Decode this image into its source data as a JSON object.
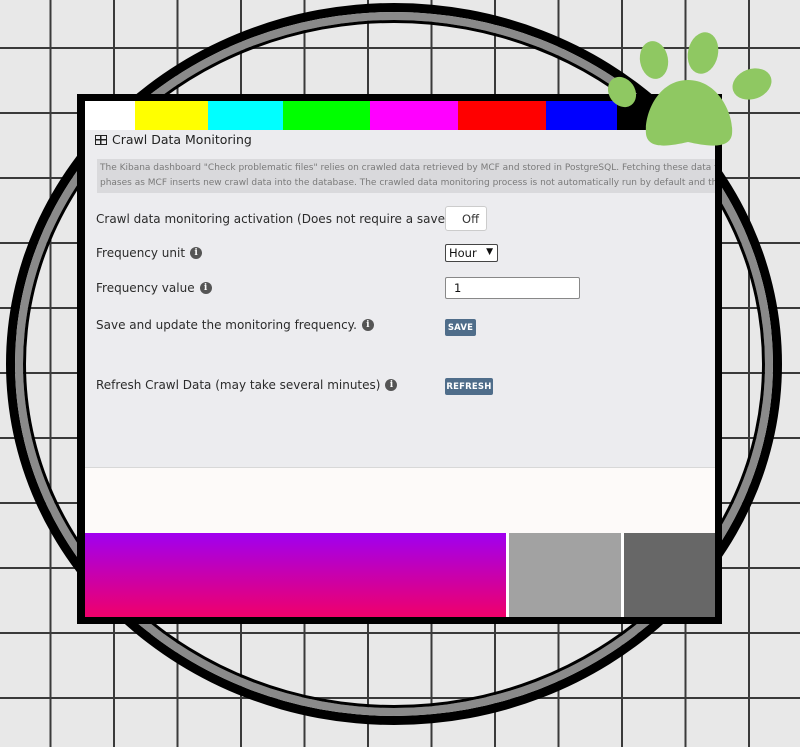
{
  "colors": {
    "bars": [
      "#ffffff",
      "#ffff00",
      "#00ffff",
      "#00ff00",
      "#ff00ff",
      "#ff0000",
      "#0000ff",
      "#000000"
    ],
    "button": "#4f6d8a",
    "paw": "#8fc862"
  },
  "panel": {
    "title": "Crawl Data Monitoring",
    "title_icon": "table-icon",
    "info_line1": "The Kibana dashboard \"Check problematic files\" relies on crawled data retrieved by MCF and stored in PostgreSQL. Fetching these data from",
    "info_line2": "phases as MCF inserts new crawl data into the database. The crawled data monitoring process is not automatically run by default and this ad"
  },
  "form": {
    "activation_label": "Crawl data monitoring activation (Does not require a save)",
    "activation_value": "Off",
    "frequency_unit_label": "Frequency unit",
    "frequency_unit_value": "Hour",
    "frequency_value_label": "Frequency value",
    "frequency_value": "1",
    "save_label": "Save and update the monitoring frequency.",
    "save_button": "SAVE",
    "refresh_label": "Refresh Crawl Data (may take several minutes)",
    "refresh_button": "REFRESH",
    "info_icon": "i"
  }
}
